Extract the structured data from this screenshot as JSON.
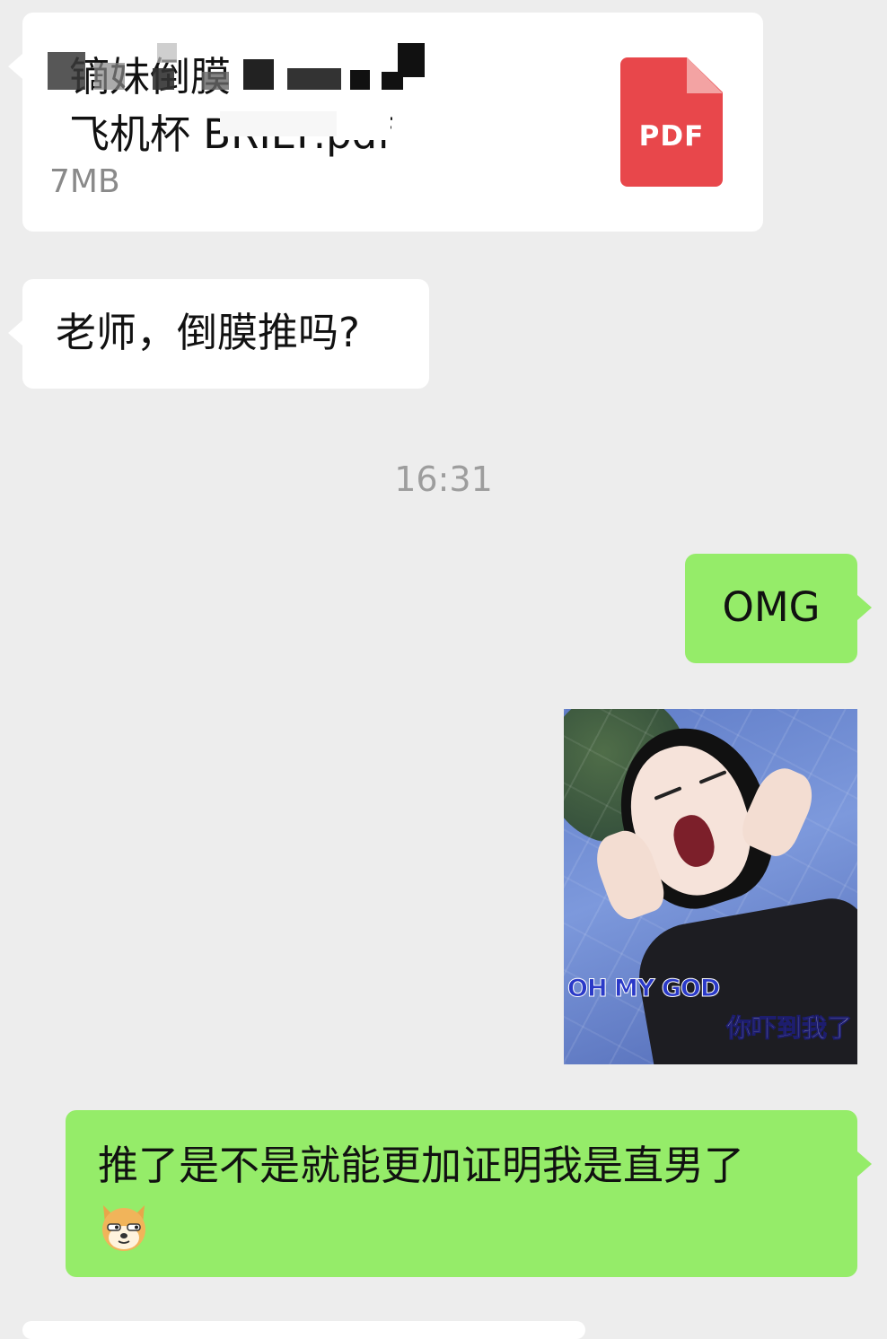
{
  "file_message": {
    "name": "镝妹倒膜\n飞机杯 BRIEF.pdf",
    "size": "7MB",
    "type_label": "PDF"
  },
  "messages": {
    "teacher_question": "老师，倒膜推吗?",
    "timestamp": "16:31",
    "omg": "OMG",
    "last": "推了是不是就能更加证明我是直男了"
  },
  "meme": {
    "caption_en": "OH MY GOD",
    "caption_cn": "你吓到我了"
  },
  "colors": {
    "background": "#ededed",
    "incoming_bubble": "#ffffff",
    "outgoing_bubble": "#95ec69",
    "pdf_red": "#e8474b",
    "timestamp_gray": "#9d9d9d"
  },
  "icons": {
    "file": "pdf-file-icon",
    "emoji": "doge-emoji-icon"
  }
}
